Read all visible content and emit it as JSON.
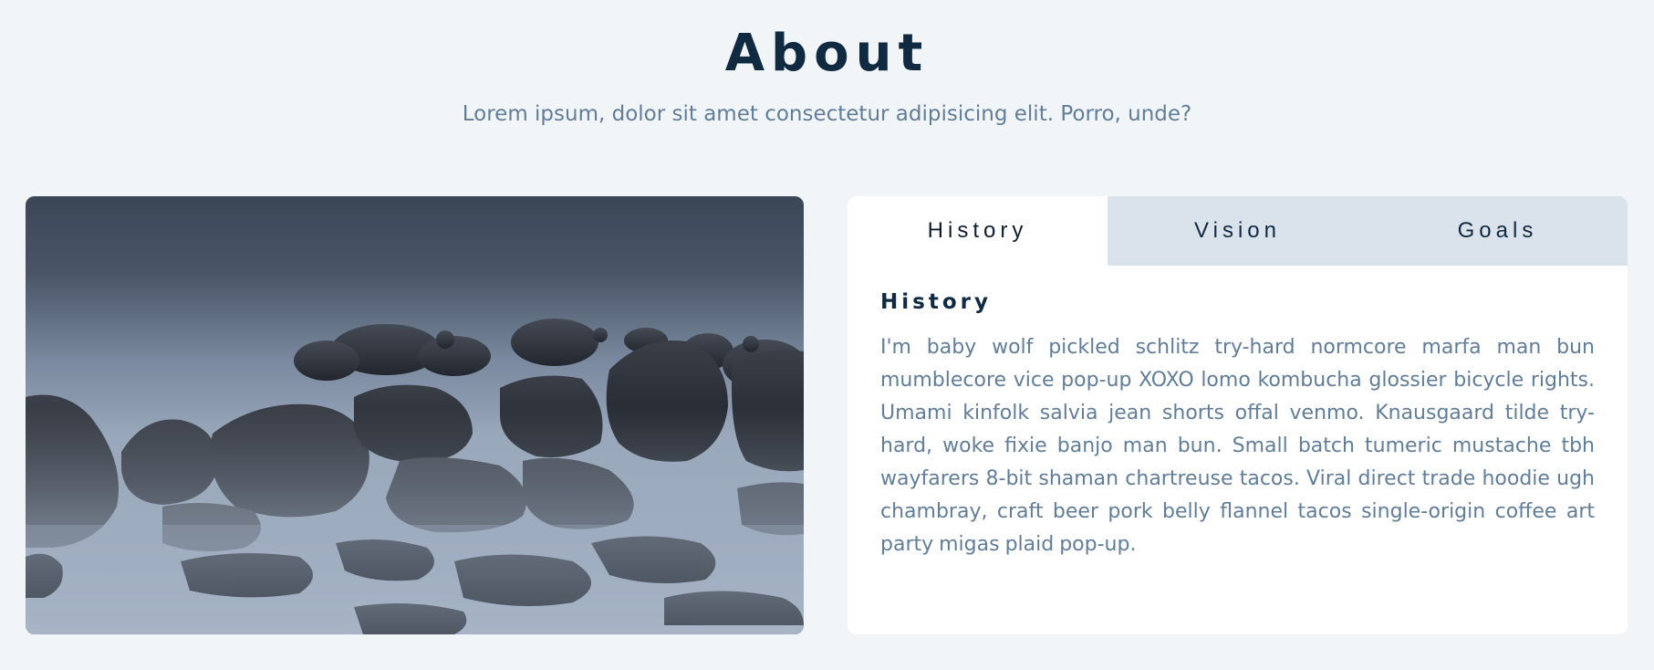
{
  "section": {
    "title": "About",
    "subtitle": "Lorem ipsum, dolor sit amet consectetur adipisicing elit. Porro, unde?"
  },
  "image": {
    "alt": "",
    "semantic": "misty-rocks-photo"
  },
  "tabs": [
    {
      "label": "History",
      "active": true
    },
    {
      "label": "Vision",
      "active": false
    },
    {
      "label": "Goals",
      "active": false
    }
  ],
  "content": {
    "heading": "History",
    "body": "I'm baby wolf pickled schlitz try-hard normcore marfa man bun mumblecore vice pop-up XOXO lomo kombucha glossier bicycle rights. Umami kinfolk salvia jean shorts offal venmo. Knausgaard tilde try-hard, woke fixie banjo man bun. Small batch tumeric mustache tbh wayfarers 8-bit shaman chartreuse tacos. Viral direct trade hoodie ugh chambray, craft beer pork belly flannel tacos single-origin coffee art party migas plaid pop-up."
  },
  "colors": {
    "background": "#f1f5f8",
    "title": "#102a42",
    "text": "#617d98",
    "tab_inactive": "#dae2ec",
    "tab_active": "#ffffff"
  }
}
